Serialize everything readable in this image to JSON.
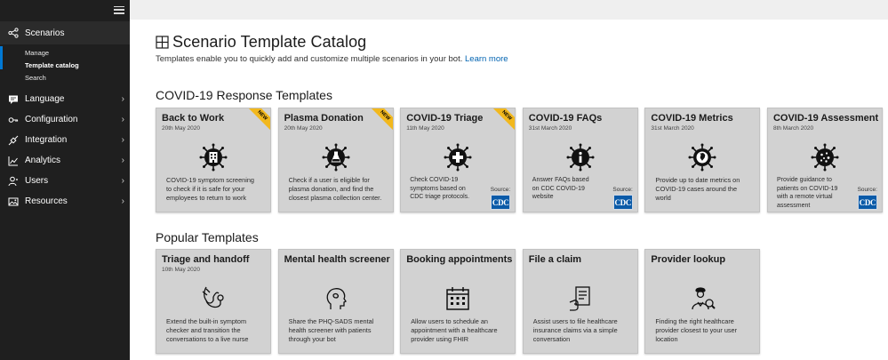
{
  "sidebar": {
    "scenarios_label": "Scenarios",
    "sub_items": [
      {
        "label": "Manage"
      },
      {
        "label": "Template catalog"
      },
      {
        "label": "Search"
      }
    ],
    "items": [
      {
        "label": "Language"
      },
      {
        "label": "Configuration"
      },
      {
        "label": "Integration"
      },
      {
        "label": "Analytics"
      },
      {
        "label": "Users"
      },
      {
        "label": "Resources"
      }
    ]
  },
  "header": {
    "title": "Scenario Template Catalog",
    "subtitle": "Templates enable you to quickly add and customize multiple scenarios in your bot.",
    "learn_more": "Learn more"
  },
  "covid_section": {
    "title": "COVID-19 Response Templates",
    "cards": [
      {
        "title": "Back to Work",
        "date": "20th May 2020",
        "badge": "NEW",
        "icon": "building-virus-icon",
        "desc": "COVID-19 symptom screening to check if it is safe for your employees to return to work"
      },
      {
        "title": "Plasma Donation",
        "date": "20th May 2020",
        "badge": "NEW",
        "icon": "flask-virus-icon",
        "desc": "Check if a user is eligible for plasma donation, and find the closest plasma collection center."
      },
      {
        "title": "COVID-19 Triage",
        "date": "11th May 2020",
        "badge": "NEW",
        "icon": "medical-cross-virus-icon",
        "desc": "Check COVID-19 symptoms based on CDC triage protocols.",
        "source": "Source:",
        "source_logo": "CDC"
      },
      {
        "title": "COVID-19 FAQs",
        "date": "31st March 2020",
        "icon": "info-virus-icon",
        "desc": "Answer FAQs based on CDC COVID-19 website",
        "source": "Source:",
        "source_logo": "CDC"
      },
      {
        "title": "COVID-19 Metrics",
        "date": "31st March 2020",
        "icon": "globe-virus-icon",
        "desc": "Provide up to date metrics on COVID-19 cases around the world"
      },
      {
        "title": "COVID-19 Assessment",
        "date": "8th March 2020",
        "icon": "virus-icon",
        "desc": "Provide guidance to patients on COVID-19 with a remote virtual assessment",
        "source": "Source:",
        "source_logo": "CDC"
      }
    ]
  },
  "popular_section": {
    "title": "Popular Templates",
    "cards": [
      {
        "title": "Triage and handoff",
        "date": "10th May 2020",
        "icon": "stethoscope-icon",
        "desc": "Extend the built-in symptom checker and transition the conversations to a live nurse"
      },
      {
        "title": "Mental health screener",
        "date": "",
        "icon": "head-profile-icon",
        "desc": "Share the PHQ-SADS mental health screener with patients through your bot"
      },
      {
        "title": "Booking appointments",
        "date": "",
        "icon": "calendar-icon",
        "desc": "Allow users to schedule an appointment with a healthcare provider using FHIR"
      },
      {
        "title": "File a claim",
        "date": "",
        "icon": "hand-document-icon",
        "desc": "Assist users to file healthcare insurance claims via a simple conversation"
      },
      {
        "title": "Provider lookup",
        "date": "",
        "icon": "doctor-search-icon",
        "desc": "Finding the right healthcare provider closest to your user location"
      }
    ]
  },
  "colors": {
    "sidebar_bg": "#1f1f1f",
    "accent": "#0078d4",
    "link": "#0063b1",
    "card_bg": "#d2d2d2",
    "badge": "#f2b81d",
    "cdc_blue": "#0a5aa8"
  }
}
